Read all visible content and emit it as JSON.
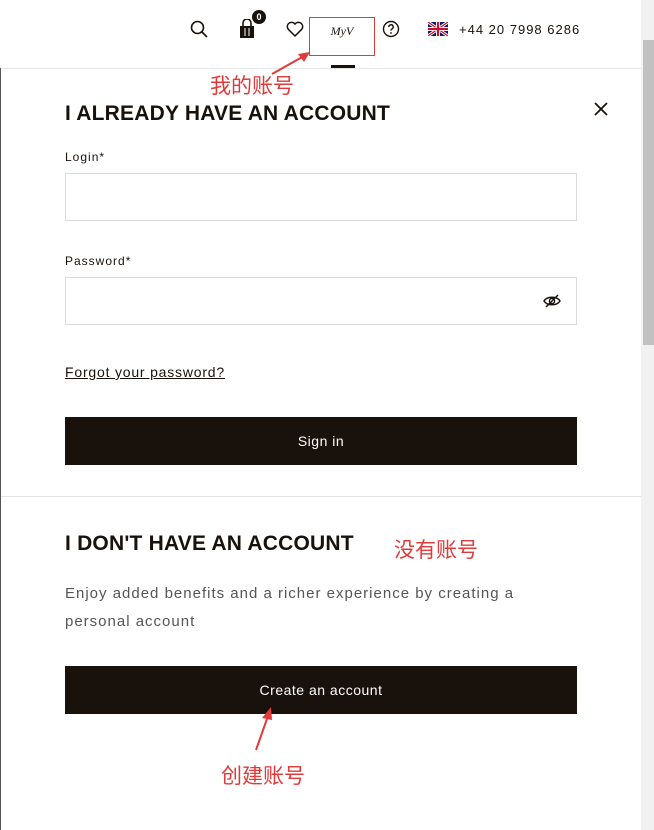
{
  "header": {
    "cart_count": "0",
    "myv_label": "MyV",
    "phone": "+44 20 7998 6286"
  },
  "annotations": {
    "my_account": "我的账号",
    "no_account": "没有账号",
    "create_account": "创建账号"
  },
  "login_section": {
    "title": "I ALREADY HAVE AN ACCOUNT",
    "login_label": "Login*",
    "login_value": "",
    "password_label": "Password*",
    "password_value": "",
    "forgot_link": "Forgot your password?",
    "sign_in_button": "Sign in"
  },
  "register_section": {
    "title": "I DON'T HAVE AN ACCOUNT",
    "description": "Enjoy added benefits and a richer experience by creating a personal account",
    "create_button": "Create an account"
  },
  "icons": [
    "search-icon",
    "shopping-bag-icon",
    "heart-icon",
    "myv-icon",
    "help-icon",
    "uk-flag-icon",
    "close-icon",
    "eye-hidden-icon"
  ],
  "colors": {
    "brand_dark": "#19110b",
    "annotation_red": "#e03a3a"
  }
}
